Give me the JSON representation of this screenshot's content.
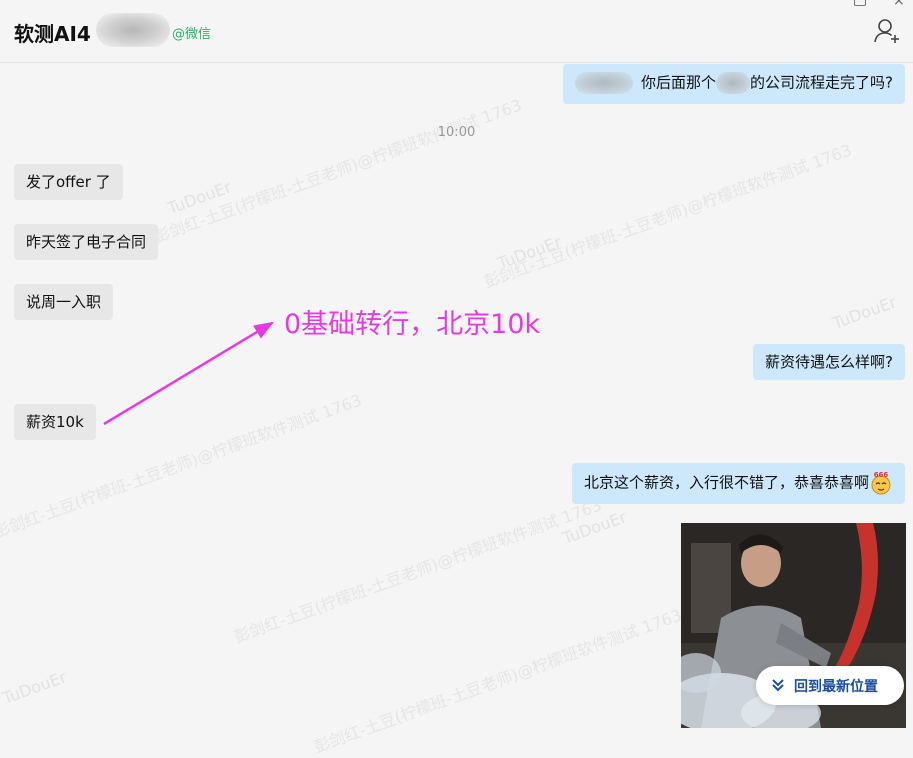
{
  "header": {
    "title": "软测AI4",
    "source_tag": "@微信",
    "add_user_icon": "add-user-icon"
  },
  "messages": {
    "out_1": {
      "pre": "",
      "text_a": "你后面那个",
      "text_b": "的公司流程走完了吗?"
    },
    "timestamp": "10:00",
    "in_1": "发了offer 了",
    "in_2": "昨天签了电子合同",
    "in_3": "说周一入职",
    "out_2": "薪资待遇怎么样啊?",
    "in_4": "薪资10k",
    "out_3": "北京这个薪资，入行很不错了，恭喜恭喜啊",
    "out_3_emoji": "666-emoji"
  },
  "annotation": {
    "text": "0基础转行，北京10k",
    "color": "#e639e3"
  },
  "watermark": {
    "line": "彭剑红-土豆(柠檬班-土豆老师)@柠檬班软件测试 1763",
    "sub": "TuDouEr"
  },
  "scroll_button": {
    "label": "回到最新位置",
    "icon": "double-chevron-down-icon"
  },
  "colors": {
    "background": "#f5f5f5",
    "incoming_bubble": "#e7e7e7",
    "outgoing_bubble": "#cde8fb",
    "wechat_green": "#2aae67"
  }
}
